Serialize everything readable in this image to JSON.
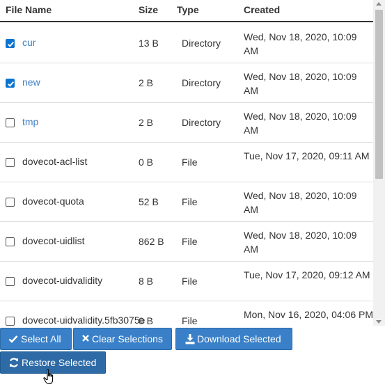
{
  "headers": {
    "file_name": "File Name",
    "size": "Size",
    "type": "Type",
    "created": "Created"
  },
  "rows": [
    {
      "checked": true,
      "link": true,
      "name": "cur",
      "size": "13 B",
      "type": "Directory",
      "created": "Wed, Nov 18, 2020, 10:09 AM"
    },
    {
      "checked": true,
      "link": true,
      "name": "new",
      "size": "2 B",
      "type": "Directory",
      "created": "Wed, Nov 18, 2020, 10:09 AM"
    },
    {
      "checked": false,
      "link": true,
      "name": "tmp",
      "size": "2 B",
      "type": "Directory",
      "created": "Wed, Nov 18, 2020, 10:09 AM"
    },
    {
      "checked": false,
      "link": false,
      "name": "dovecot-acl-list",
      "size": "0 B",
      "type": "File",
      "created": "Tue, Nov 17, 2020, 09:11 AM"
    },
    {
      "checked": false,
      "link": false,
      "name": "dovecot-quota",
      "size": "52 B",
      "type": "File",
      "created": "Wed, Nov 18, 2020, 10:09 AM"
    },
    {
      "checked": false,
      "link": false,
      "name": "dovecot-uidlist",
      "size": "862 B",
      "type": "File",
      "created": "Wed, Nov 18, 2020, 10:09 AM"
    },
    {
      "checked": false,
      "link": false,
      "name": "dovecot-uidvalidity",
      "size": "8 B",
      "type": "File",
      "created": "Tue, Nov 17, 2020, 09:12 AM"
    },
    {
      "checked": false,
      "link": false,
      "name": "dovecot-uidvalidity.5fb3075e",
      "size": "0 B",
      "type": "File",
      "created": "Mon, Nov 16, 2020, 04:06 PM"
    }
  ],
  "buttons": {
    "select_all": {
      "label": "Select All",
      "icon": "check-icon"
    },
    "clear_selections": {
      "label": "Clear Selections",
      "icon": "times-icon"
    },
    "download_selected": {
      "label": "Download Selected",
      "icon": "download-icon"
    },
    "restore_selected": {
      "label": "Restore Selected",
      "icon": "refresh-icon"
    }
  },
  "colors": {
    "link": "#3f80c4",
    "button": "#3a80c8",
    "checkbox_checked": "#0b74d1"
  }
}
